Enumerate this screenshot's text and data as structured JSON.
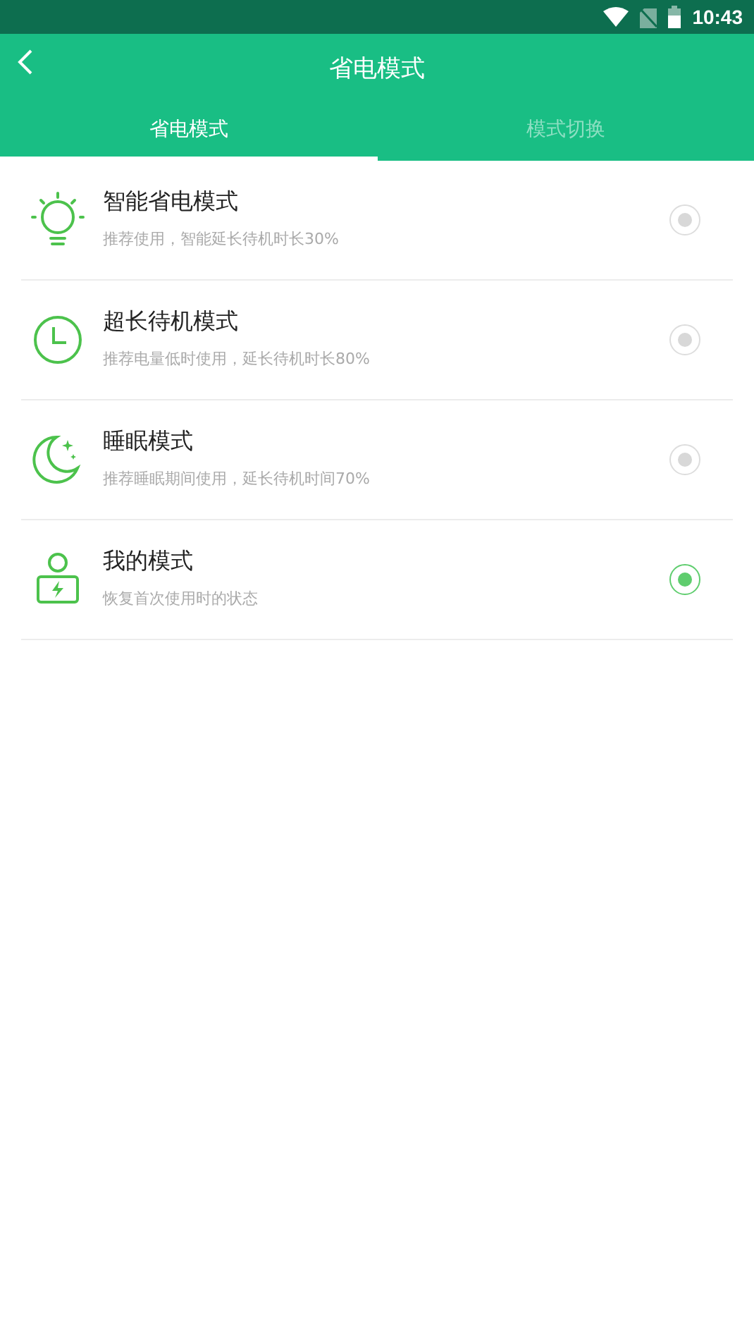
{
  "status_bar": {
    "time": "10:43"
  },
  "header": {
    "title": "省电模式"
  },
  "tabs": [
    {
      "label": "省电模式",
      "selected": true
    },
    {
      "label": "模式切换",
      "selected": false
    }
  ],
  "modes": [
    {
      "title": "智能省电模式",
      "subtitle": "推荐使用，智能延长待机时长30%",
      "selected": false
    },
    {
      "title": "超长待机模式",
      "subtitle": "推荐电量低时使用，延长待机时长80%",
      "selected": false
    },
    {
      "title": "睡眠模式",
      "subtitle": "推荐睡眠期间使用，延长待机时间70%",
      "selected": false
    },
    {
      "title": "我的模式",
      "subtitle": "恢复首次使用时的状态",
      "selected": true
    }
  ]
}
